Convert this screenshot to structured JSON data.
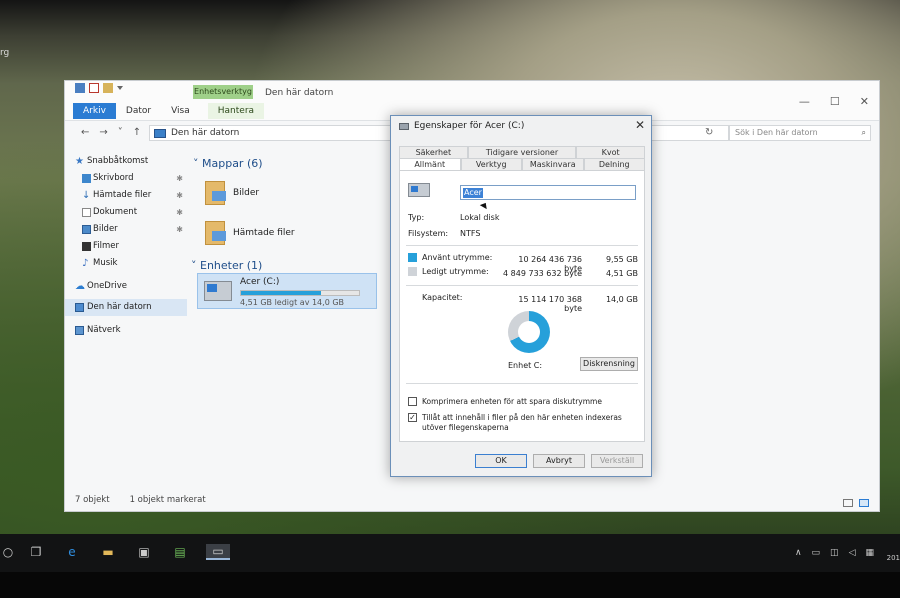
{
  "desktop": {
    "left_label": "rg"
  },
  "explorer": {
    "context_tab": "Enhetsverktyg",
    "title": "Den här datorn",
    "tabs": [
      "Arkiv",
      "Dator",
      "Visa",
      "Hantera"
    ],
    "window_controls": {
      "minimize": "—",
      "maximize": "☐",
      "close": "✕"
    },
    "nav": {
      "back": "←",
      "forward": "→",
      "recent": "˅",
      "up": "↑"
    },
    "address": "Den här datorn",
    "search_placeholder": "Sök i Den här datorn",
    "sidebar": [
      {
        "label": "Snabbåtkomst",
        "icon": "star-icon",
        "pin": false,
        "section": true
      },
      {
        "label": "Skrivbord",
        "icon": "desktop-icon",
        "pin": true
      },
      {
        "label": "Hämtade filer",
        "icon": "download-icon",
        "pin": true
      },
      {
        "label": "Dokument",
        "icon": "document-icon",
        "pin": true
      },
      {
        "label": "Bilder",
        "icon": "pictures-icon",
        "pin": true
      },
      {
        "label": "Filmer",
        "icon": "film-icon",
        "pin": false
      },
      {
        "label": "Musik",
        "icon": "music-icon",
        "pin": false
      },
      {
        "label": "OneDrive",
        "icon": "cloud-icon",
        "section": true
      },
      {
        "label": "Den här datorn",
        "icon": "computer-icon",
        "section": true,
        "active": true
      },
      {
        "label": "Nätverk",
        "icon": "network-icon",
        "section": true
      }
    ],
    "groups": {
      "folders_heading": "Mappar (6)",
      "folders": [
        "Bilder",
        "Hämtade filer"
      ],
      "devices_heading": "Enheter (1)"
    },
    "drive": {
      "name": "Acer (C:)",
      "free_text": "4,51 GB ledigt av 14,0 GB",
      "used_fraction": 0.678
    },
    "status": {
      "items": "7 objekt",
      "selected": "1 objekt markerat"
    }
  },
  "dialog": {
    "title": "Egenskaper för Acer (C:)",
    "close": "✕",
    "tabs_top": [
      "Säkerhet",
      "Tidigare versioner",
      "Kvot"
    ],
    "tabs_bottom": [
      "Allmänt",
      "Verktyg",
      "Maskinvara",
      "Delning"
    ],
    "name_value": "Acer",
    "type_label": "Typ:",
    "type_value": "Lokal disk",
    "fs_label": "Filsystem:",
    "fs_value": "NTFS",
    "used_label": "Använt utrymme:",
    "used_bytes": "10 264 436 736 byte",
    "used_gb": "9,55 GB",
    "free_label": "Ledigt utrymme:",
    "free_bytes": "4 849 733 632 byte",
    "free_gb": "4,51 GB",
    "capacity_label": "Kapacitet:",
    "capacity_bytes": "15 114 170 368 byte",
    "capacity_gb": "14,0 GB",
    "drive_label": "Enhet C:",
    "cleanup_button": "Diskrensning",
    "compress_label": "Komprimera enheten för att spara diskutrymme",
    "index_label": "Tillåt att innehåll i filer på den här enheten indexeras utöver filegenskaperna",
    "compress_checked": false,
    "index_checked": true,
    "ok": "OK",
    "cancel": "Avbryt",
    "apply": "Verkställ",
    "colors": {
      "used": "#26a0da",
      "free": "#cfd3d8"
    },
    "used_fraction": 0.679
  },
  "taskbar": {
    "clock": "201"
  }
}
